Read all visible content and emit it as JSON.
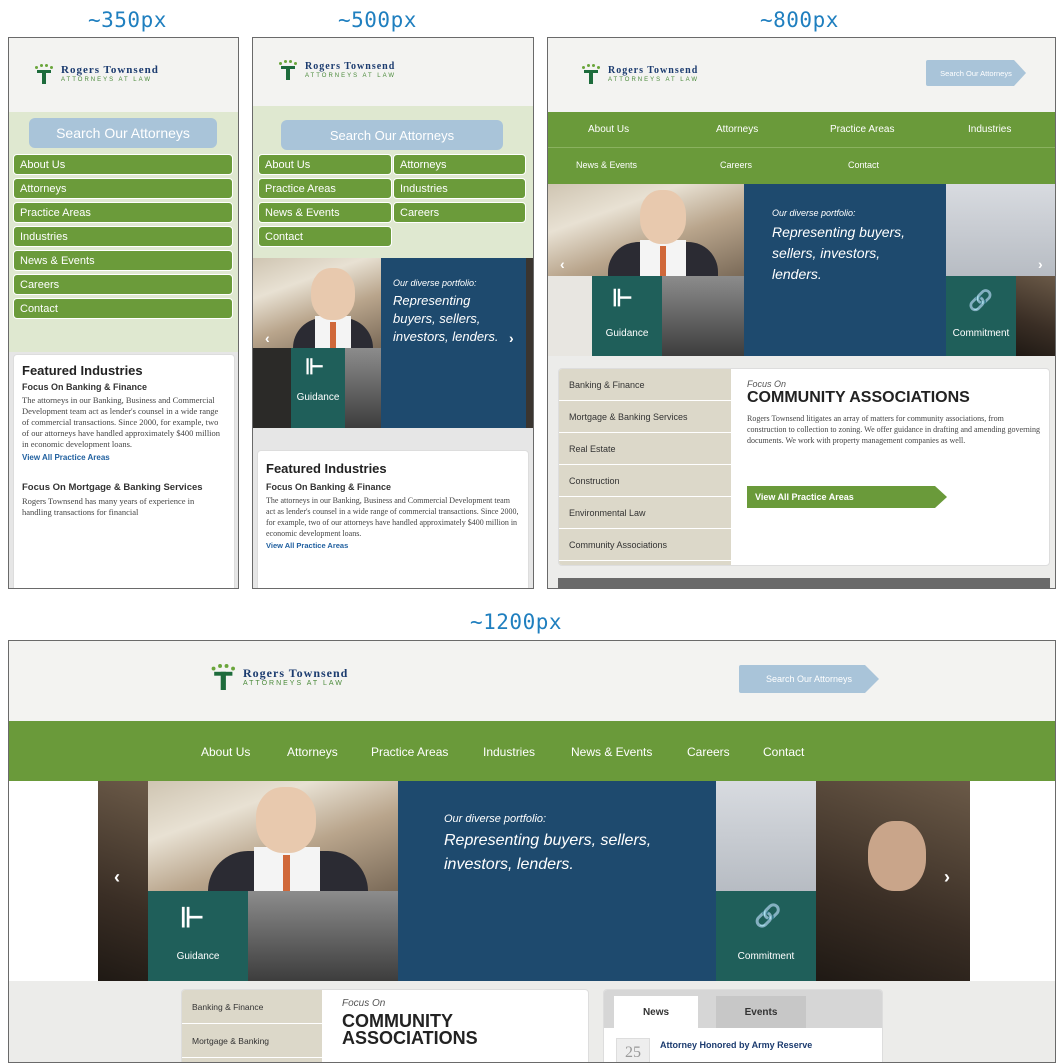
{
  "labels": {
    "w350": "~350px",
    "w500": "~500px",
    "w800": "~800px",
    "w1200": "~1200px"
  },
  "brand": {
    "name": "Rogers Townsend",
    "sub": "ATTORNEYS AT LAW"
  },
  "search": {
    "label": "Search Our Attorneys"
  },
  "nav": [
    "About Us",
    "Attorneys",
    "Practice Areas",
    "Industries",
    "News & Events",
    "Careers",
    "Contact"
  ],
  "hero": {
    "intro": "Our diverse portfolio:",
    "line": "Representing buyers, sellers, investors, lenders.",
    "tile_left": "Guidance",
    "tile_right": "Commitment"
  },
  "featured": {
    "title": "Featured Industries",
    "h1": "Focus On Banking & Finance",
    "p1": "The attorneys in our Banking, Business and Commercial Development team act as lender's counsel in a wide range of commercial transactions. Since 2000, for example, two of our attorneys have handled approximately $400 million in economic development loans.",
    "link": "View All Practice Areas",
    "h2": "Focus On Mortgage & Banking Services",
    "p2": "Rogers Townsend has many years of experience in handling transactions for financial"
  },
  "industries": [
    "Banking & Finance",
    "Mortgage & Banking Services",
    "Real Estate",
    "Construction",
    "Environmental Law",
    "Community Associations"
  ],
  "focus": {
    "kicker": "Focus On",
    "title": "COMMUNITY ASSOCIATIONS",
    "title_l1": "COMMUNITY",
    "title_l2": "ASSOCIATIONS",
    "body": "Rogers Townsend litigates an array of matters for community associations, from construction to collection to zoning. We offer guidance in drafting and amending governing documents. We work with property management companies as well.",
    "btn": "View All Practice Areas"
  },
  "lg_industries": [
    "Banking & Finance",
    "Mortgage & Banking"
  ],
  "news": {
    "tab1": "News",
    "tab2": "Events",
    "date": "25",
    "headline": "Attorney Honored by Army Reserve"
  },
  "colors": {
    "green": "#6a9a3a",
    "navy": "#1e4a6e",
    "teal": "#1f5f5a",
    "search": "#a9c4d9",
    "title_blue": "#1f7fbf"
  }
}
